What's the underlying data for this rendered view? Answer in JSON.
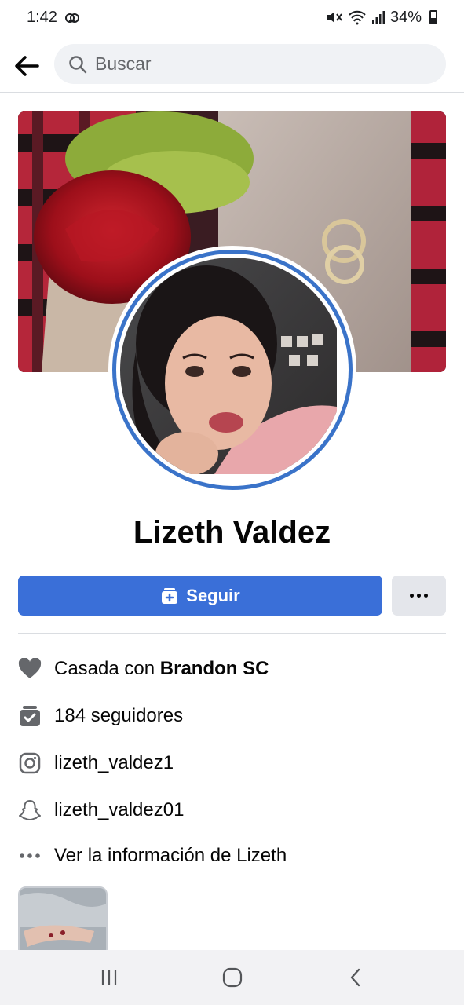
{
  "status_bar": {
    "time": "1:42",
    "battery": "34%"
  },
  "search": {
    "placeholder": "Buscar"
  },
  "profile": {
    "name": "Lizeth Valdez"
  },
  "actions": {
    "follow_label": "Seguir"
  },
  "info": {
    "relationship_prefix": "Casada con ",
    "relationship_partner": "Brandon SC",
    "followers": "184 seguidores",
    "instagram": "lizeth_valdez1",
    "snapchat": "lizeth_valdez01",
    "more_info": "Ver la información de Lizeth"
  },
  "colors": {
    "accent": "#3a6fd8",
    "ring": "#3a73c9",
    "secondary_button": "#e4e6eb"
  }
}
